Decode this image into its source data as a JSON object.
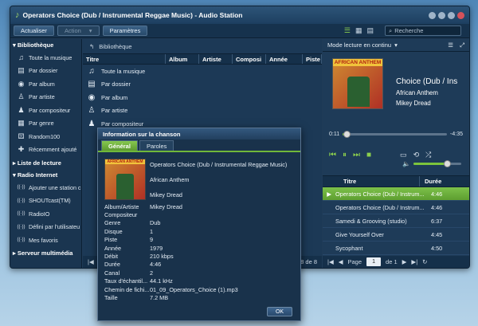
{
  "window": {
    "title": "Operators Choice (Dub / Instrumental Reggae Music) - Audio Station"
  },
  "toolbar": {
    "refresh": "Actualiser",
    "action": "Action",
    "settings": "Paramètres",
    "search_placeholder": "Recherche"
  },
  "sidebar": {
    "library_title": "Bibliothèque",
    "library_items": [
      {
        "icon": "music-note-icon",
        "label": "Toute la musique"
      },
      {
        "icon": "folder-icon",
        "label": "Par dossier"
      },
      {
        "icon": "disc-icon",
        "label": "Par album"
      },
      {
        "icon": "person-icon",
        "label": "Par artiste"
      },
      {
        "icon": "composer-icon",
        "label": "Par compositeur"
      },
      {
        "icon": "genre-icon",
        "label": "Par genre"
      },
      {
        "icon": "random-icon",
        "label": "Random100"
      },
      {
        "icon": "recent-icon",
        "label": "Récemment ajouté"
      }
    ],
    "playlist_title": "Liste de lecture",
    "radio_title": "Radio Internet",
    "radio_items": [
      {
        "icon": "radio-icon",
        "label": "Ajouter une station c"
      },
      {
        "icon": "radio-icon",
        "label": "SHOUTcast(TM)"
      },
      {
        "icon": "radio-icon",
        "label": "RadioIO"
      },
      {
        "icon": "radio-icon",
        "label": "Défini par l'utilisateu"
      },
      {
        "icon": "radio-icon",
        "label": "Mes favoris"
      }
    ],
    "media_server_title": "Serveur multimédia"
  },
  "center": {
    "breadcrumb": "Bibliothèque",
    "columns": [
      "Titre",
      "Album",
      "Artiste",
      "Composi",
      "Année",
      "Piste"
    ],
    "rows": [
      {
        "icon": "music-note-icon",
        "label": "Toute la musique"
      },
      {
        "icon": "folder-icon",
        "label": "Par dossier"
      },
      {
        "icon": "disc-icon",
        "label": "Par album"
      },
      {
        "icon": "person-icon",
        "label": "Par artiste"
      },
      {
        "icon": "composer-icon",
        "label": "Par compositeur"
      }
    ],
    "footer_count": "8 de 8"
  },
  "player": {
    "mode": "Mode lecture en continu",
    "album_art_text": "AFRICAN ANTHEM",
    "track_title": "Choice (Dub / Ins",
    "album": "African Anthem",
    "artist": "Mikey Dread",
    "elapsed": "0:11",
    "remaining": "-4:35",
    "progress": 0.04,
    "volume": 0.7
  },
  "playlist": {
    "columns": [
      "Titre",
      "Durée"
    ],
    "rows": [
      {
        "title": "Operators Choice (Dub / Instrum...",
        "duration": "4:46",
        "selected": true
      },
      {
        "title": "Operators Choice (Dub / Instrum...",
        "duration": "4:46"
      },
      {
        "title": "Samedi & Grooving (studio)",
        "duration": "6:37"
      },
      {
        "title": "Give Yourself Over",
        "duration": "4:45"
      },
      {
        "title": "Sycophant",
        "duration": "4:50"
      }
    ],
    "page_label": "Page",
    "page_value": "1",
    "page_of": "de 1"
  },
  "dialog": {
    "title": "Information sur la chanson",
    "tabs": [
      "Général",
      "Paroles"
    ],
    "header": {
      "title": "Operators Choice (Dub / Instrumental Reggae Music)",
      "album": "African Anthem",
      "artist": "Mikey Dread"
    },
    "properties": [
      {
        "k": "Album/Artiste",
        "v": "Mikey Dread"
      },
      {
        "k": "Compositeur",
        "v": ""
      },
      {
        "k": "Genre",
        "v": "Dub"
      },
      {
        "k": "Disque",
        "v": "1"
      },
      {
        "k": "Piste",
        "v": "9"
      },
      {
        "k": "Année",
        "v": "1979"
      },
      {
        "k": "Débit",
        "v": "210 kbps"
      },
      {
        "k": "Durée",
        "v": "4:46"
      },
      {
        "k": "Canal",
        "v": "2"
      },
      {
        "k": "Taux d'échantil...",
        "v": "44.1 kHz"
      },
      {
        "k": "Chemin de fichi...",
        "v": "01_09_Operators_Choice (1).mp3"
      },
      {
        "k": "Taille",
        "v": "7.2 MB"
      }
    ],
    "ok": "OK"
  }
}
